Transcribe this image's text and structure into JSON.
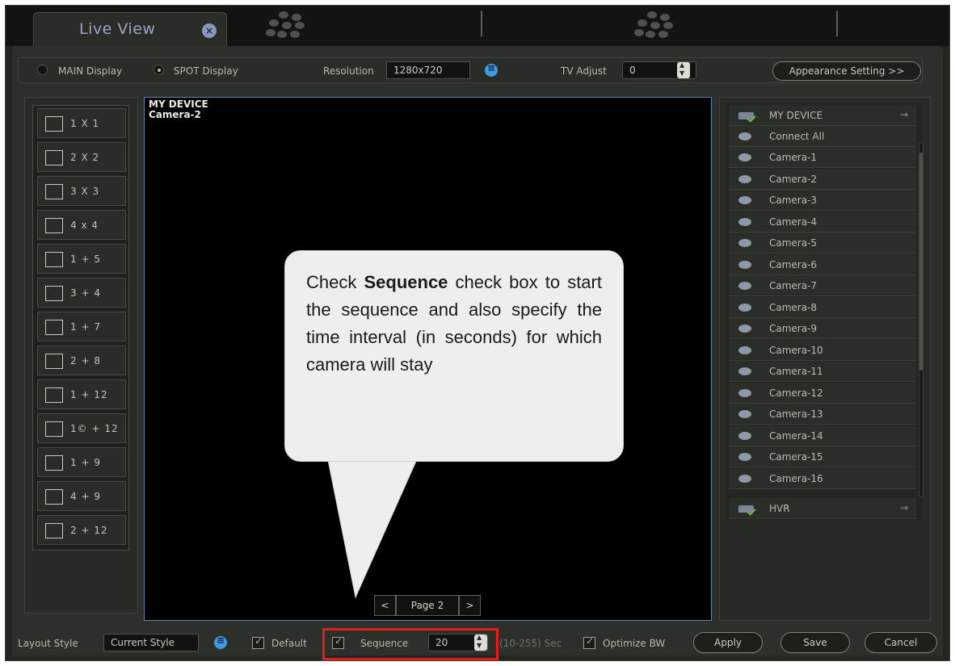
{
  "tab": {
    "title": "Live View",
    "close": "×"
  },
  "options": {
    "main_display": "MAIN Display",
    "spot_display": "SPOT Display",
    "resolution_label": "Resolution",
    "resolution_value": "1280x720",
    "tv_adjust_label": "TV Adjust",
    "tv_adjust_value": "0",
    "appearance_button": "Appearance Setting >>"
  },
  "layouts": [
    "1 X 1",
    "2 X 2",
    "3 X 3",
    "4 x 4",
    "1 + 5",
    "3 + 4",
    "1 + 7",
    "2 + 8",
    "1 + 12",
    "1© + 12",
    "1 + 9",
    "4 + 9",
    "2 + 12"
  ],
  "video": {
    "device": "MY DEVICE",
    "camera": "Camera-2",
    "page_label": "Page 2",
    "prev": "<",
    "next": ">"
  },
  "devices": {
    "root": "MY DEVICE",
    "connect_all": "Connect All",
    "cameras": [
      "Camera-1",
      "Camera-2",
      "Camera-3",
      "Camera-4",
      "Camera-5",
      "Camera-6",
      "Camera-7",
      "Camera-8",
      "Camera-9",
      "Camera-10",
      "Camera-11",
      "Camera-12",
      "Camera-13",
      "Camera-14",
      "Camera-15",
      "Camera-16"
    ],
    "hvr": "HVR",
    "arrow": "→"
  },
  "bottom": {
    "layout_style_label": "Layout Style",
    "layout_style_value": "Current Style",
    "default_label": "Default",
    "sequence_label": "Sequence",
    "sequence_value": "20",
    "range_label": "(10-255) Sec",
    "optimize_label": "Optimize BW",
    "apply": "Apply",
    "save": "Save",
    "cancel": "Cancel"
  },
  "callout": {
    "pre": "Check ",
    "bold": "Sequence",
    "post": " check box to start the sequence and also specify the time interval (in seconds) for which camera will stay"
  },
  "colors": {
    "highlight": "#e31c1c",
    "accent_blue": "#3f9be0",
    "video_border": "#5f83b0"
  }
}
